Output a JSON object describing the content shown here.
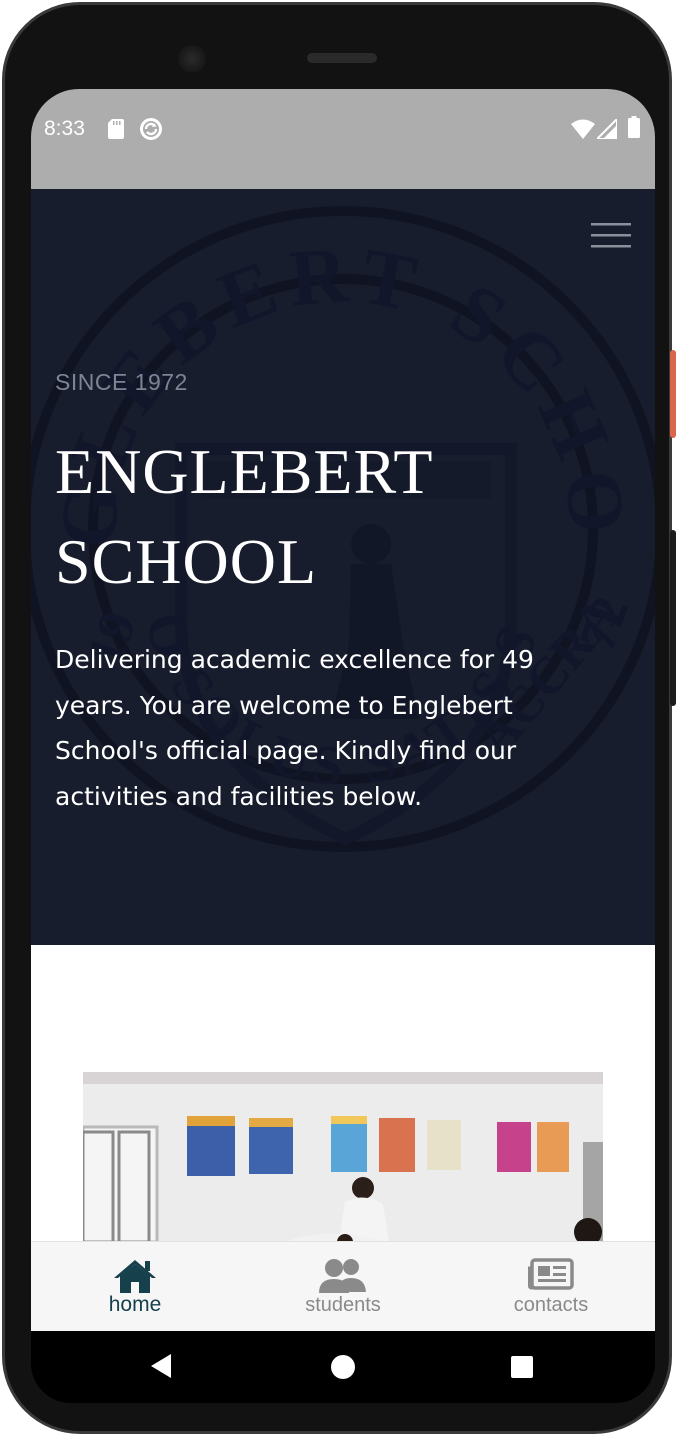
{
  "statusbar": {
    "time": "8:33",
    "icons": [
      "sd-card-icon",
      "sync-icon",
      "wifi-icon",
      "signal-icon",
      "battery-icon"
    ]
  },
  "hero": {
    "since": "SINCE 1972",
    "title_line1": "ENGLEBERT",
    "title_line2": "SCHOOL",
    "description": "Delivering academic excellence for 49 years. You are welcome to  Englebert School's official page. Kindly find our activities and facilities below.",
    "crest_text_top": "ENGLEBERT SCHOOL",
    "crest_text_bottom": "NEMO SOLUS SATIS SAPIT",
    "crest_year_left": "19",
    "crest_year_right": "72",
    "crest_city": "ACCRA",
    "background_color": "#181d2d"
  },
  "bottom_nav": {
    "items": [
      {
        "label": "home",
        "icon": "home-icon",
        "active": true
      },
      {
        "label": "students",
        "icon": "people-icon",
        "active": false
      },
      {
        "label": "contacts",
        "icon": "newspaper-icon",
        "active": false
      }
    ],
    "active_color": "#17404d",
    "inactive_color": "#8a8a8a"
  },
  "system_nav": {
    "icons": [
      "back-icon",
      "home-circle-icon",
      "recents-icon"
    ]
  }
}
